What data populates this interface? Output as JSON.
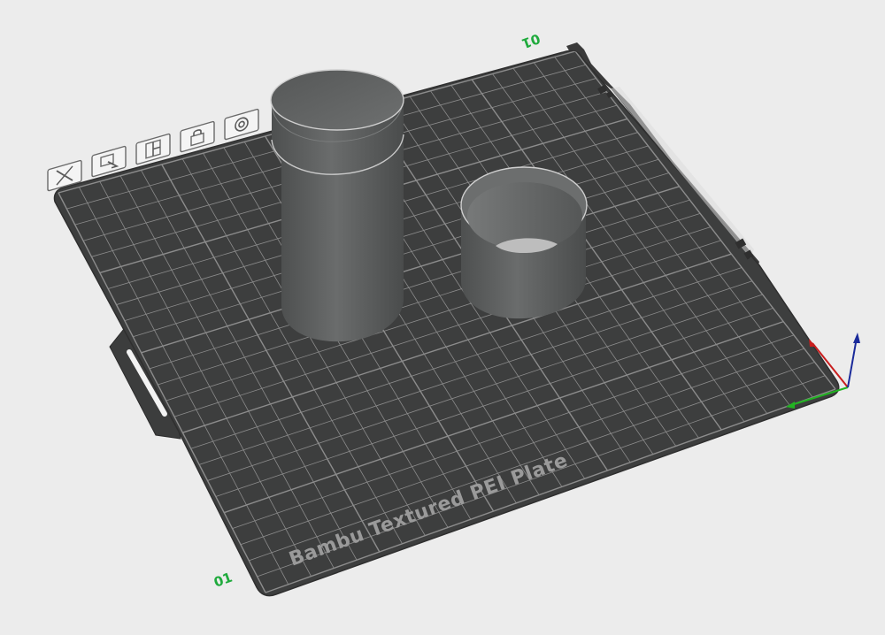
{
  "viewport": {
    "background": "#ececec",
    "plate": {
      "label": "Bambu Textured PEI Plate",
      "number_top": "01",
      "number_bottom": "01",
      "plate_color": "#3d3e3e",
      "grid_color": "#8c8c8c",
      "frame_color": "#444444"
    },
    "plate_toolbar": {
      "buttons": [
        {
          "name": "delete-plate-button",
          "icon": "close-icon"
        },
        {
          "name": "arrange-plate-button",
          "icon": "arrange-icon"
        },
        {
          "name": "plate-layout-button",
          "icon": "layout-icon"
        },
        {
          "name": "lock-plate-button",
          "icon": "lock-icon"
        },
        {
          "name": "plate-settings-button",
          "icon": "gear-icon"
        }
      ]
    },
    "objects": [
      {
        "name": "tall-cylinder",
        "shape": "cylinder",
        "color": "#5a5c5c"
      },
      {
        "name": "short-cylinder",
        "shape": "open-cylinder",
        "color": "#5a5c5c"
      }
    ],
    "axes": {
      "x_color": "#c81e1e",
      "y_color": "#22b322",
      "z_color": "#1a2a9a"
    }
  }
}
